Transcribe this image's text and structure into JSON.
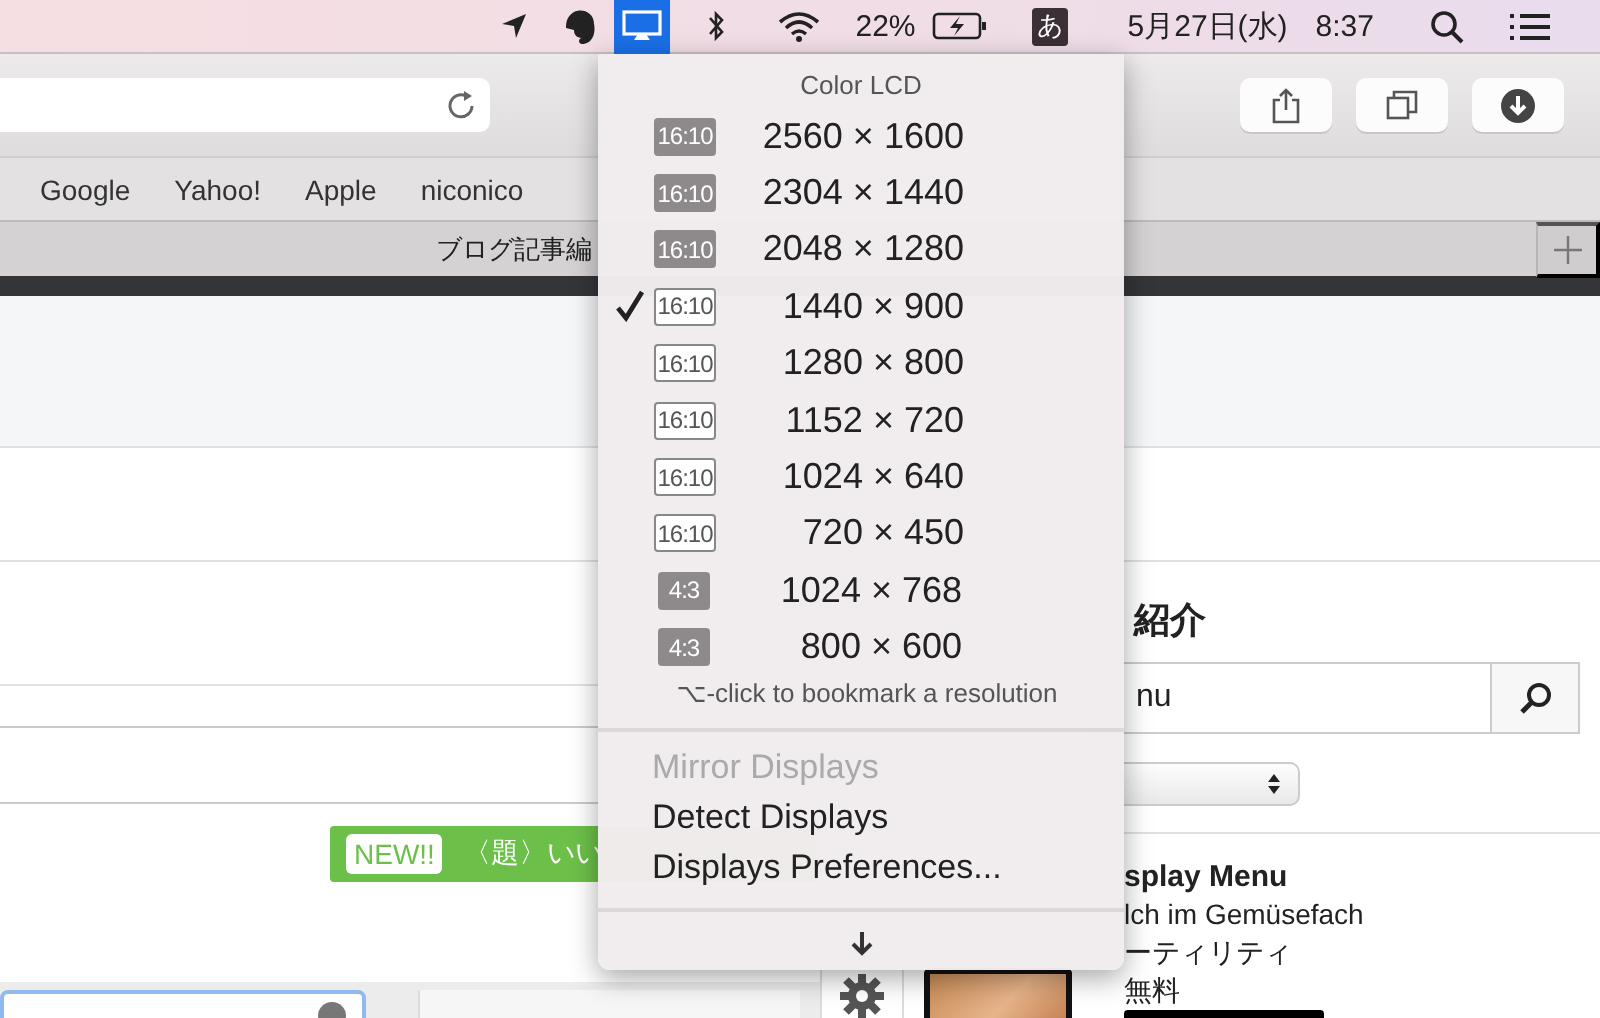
{
  "menubar": {
    "battery_percent": "22%",
    "input_method": "あ",
    "date": "5月27日(水)",
    "time": "8:37"
  },
  "browser": {
    "bookmarks": [
      "Google",
      "Yahoo!",
      "Apple",
      "niconico"
    ],
    "tab_title": "ブログ記事編"
  },
  "display_menu": {
    "title": "Color LCD",
    "resolutions": [
      {
        "badge": "16:10",
        "kind": "filled",
        "checked": false,
        "resolution": "2560 × 1600"
      },
      {
        "badge": "16:10",
        "kind": "filled",
        "checked": false,
        "resolution": "2304 × 1440"
      },
      {
        "badge": "16:10",
        "kind": "filled",
        "checked": false,
        "resolution": "2048 × 1280"
      },
      {
        "badge": "16:10",
        "kind": "outline",
        "checked": true,
        "resolution": "1440 × 900"
      },
      {
        "badge": "16:10",
        "kind": "outline",
        "checked": false,
        "resolution": "1280 × 800"
      },
      {
        "badge": "16:10",
        "kind": "outline",
        "checked": false,
        "resolution": "1152 × 720"
      },
      {
        "badge": "16:10",
        "kind": "outline",
        "checked": false,
        "resolution": "1024 × 640"
      },
      {
        "badge": "16:10",
        "kind": "outline",
        "checked": false,
        "resolution": "720 × 450"
      },
      {
        "badge": "4:3",
        "kind": "filled",
        "checked": false,
        "resolution": "1024 × 768"
      },
      {
        "badge": "4:3",
        "kind": "filled",
        "checked": false,
        "resolution": "800 × 600"
      }
    ],
    "hint": "⌥-click to bookmark a resolution",
    "items": [
      {
        "label": "Mirror Displays",
        "disabled": true
      },
      {
        "label": "Detect Displays",
        "disabled": false
      },
      {
        "label": "Displays Preferences...",
        "disabled": false
      }
    ]
  },
  "page": {
    "banner": {
      "badge": "NEW!!",
      "text": "〈題〉いい"
    },
    "sidebar": {
      "heading": "紹介",
      "search_value": "nu",
      "app": {
        "name": "splay Menu",
        "subtitle": "lch im Gemüsefach",
        "category": "ーティリティ",
        "price": "無料"
      }
    }
  }
}
